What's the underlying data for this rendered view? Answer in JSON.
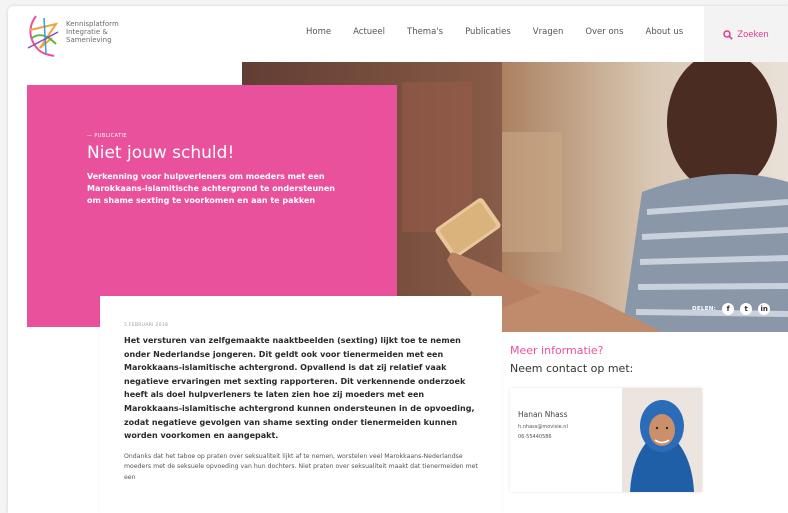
{
  "logo": {
    "line1": "Kennisplatform",
    "line2": "Integratie &",
    "line3": "Samenleving"
  },
  "nav": [
    {
      "label": "Home"
    },
    {
      "label": "Actueel"
    },
    {
      "label": "Thema's"
    },
    {
      "label": "Publicaties"
    },
    {
      "label": "Vragen"
    },
    {
      "label": "Over ons"
    },
    {
      "label": "About us"
    }
  ],
  "search": {
    "label": "Zoeken",
    "icon": "search-icon"
  },
  "hero": {
    "tag": "— PUBLICATIE",
    "title": "Niet jouw schuld!",
    "subtitle": "Verkenning voor hulpverleners om moeders met een Marokkaans-islamitische achtergrond te ondersteunen om shame sexting te voorkomen en aan te pakken"
  },
  "share": {
    "label": "DELEN:",
    "icons": [
      {
        "name": "facebook-icon",
        "glyph": "f"
      },
      {
        "name": "twitter-icon",
        "glyph": "t"
      },
      {
        "name": "linkedin-icon",
        "glyph": "in"
      }
    ]
  },
  "article": {
    "date": "5 FEBRUARI 2018",
    "intro": "Het versturen van zelfgemaakte naaktbeelden (sexting) lijkt toe te nemen onder Nederlandse jongeren. Dit geldt ook voor tienermeiden met een Marokkaans-islamitische achtergrond. Opvallend is dat zij relatief vaak negatieve ervaringen met sexting rapporteren. Dit verkennende onderzoek heeft als doel hulpverleners te laten zien hoe zij moeders met een Marokkaans-islamitische achtergrond kunnen ondersteunen in de opvoeding, zodat negatieve gevolgen van shame sexting onder tienermeiden kunnen worden voorkomen en aangepakt.",
    "body": "Ondanks dat het taboe op praten over seksualiteit lijkt af te nemen, worstelen veel Marokkaans-Nederlandse moeders met de seksuele opvoeding van hun dochters. Niet praten over seksualiteit maakt dat tienermeiden met een"
  },
  "contact": {
    "title": "Meer informatie?",
    "subtitle": "Neem contact op met:",
    "name": "Hanan Nhass",
    "email": "h.nhass@movisie.nl",
    "phone": "06-55440586"
  },
  "colors": {
    "accent": "#e9519c",
    "search": "#e7358d"
  }
}
